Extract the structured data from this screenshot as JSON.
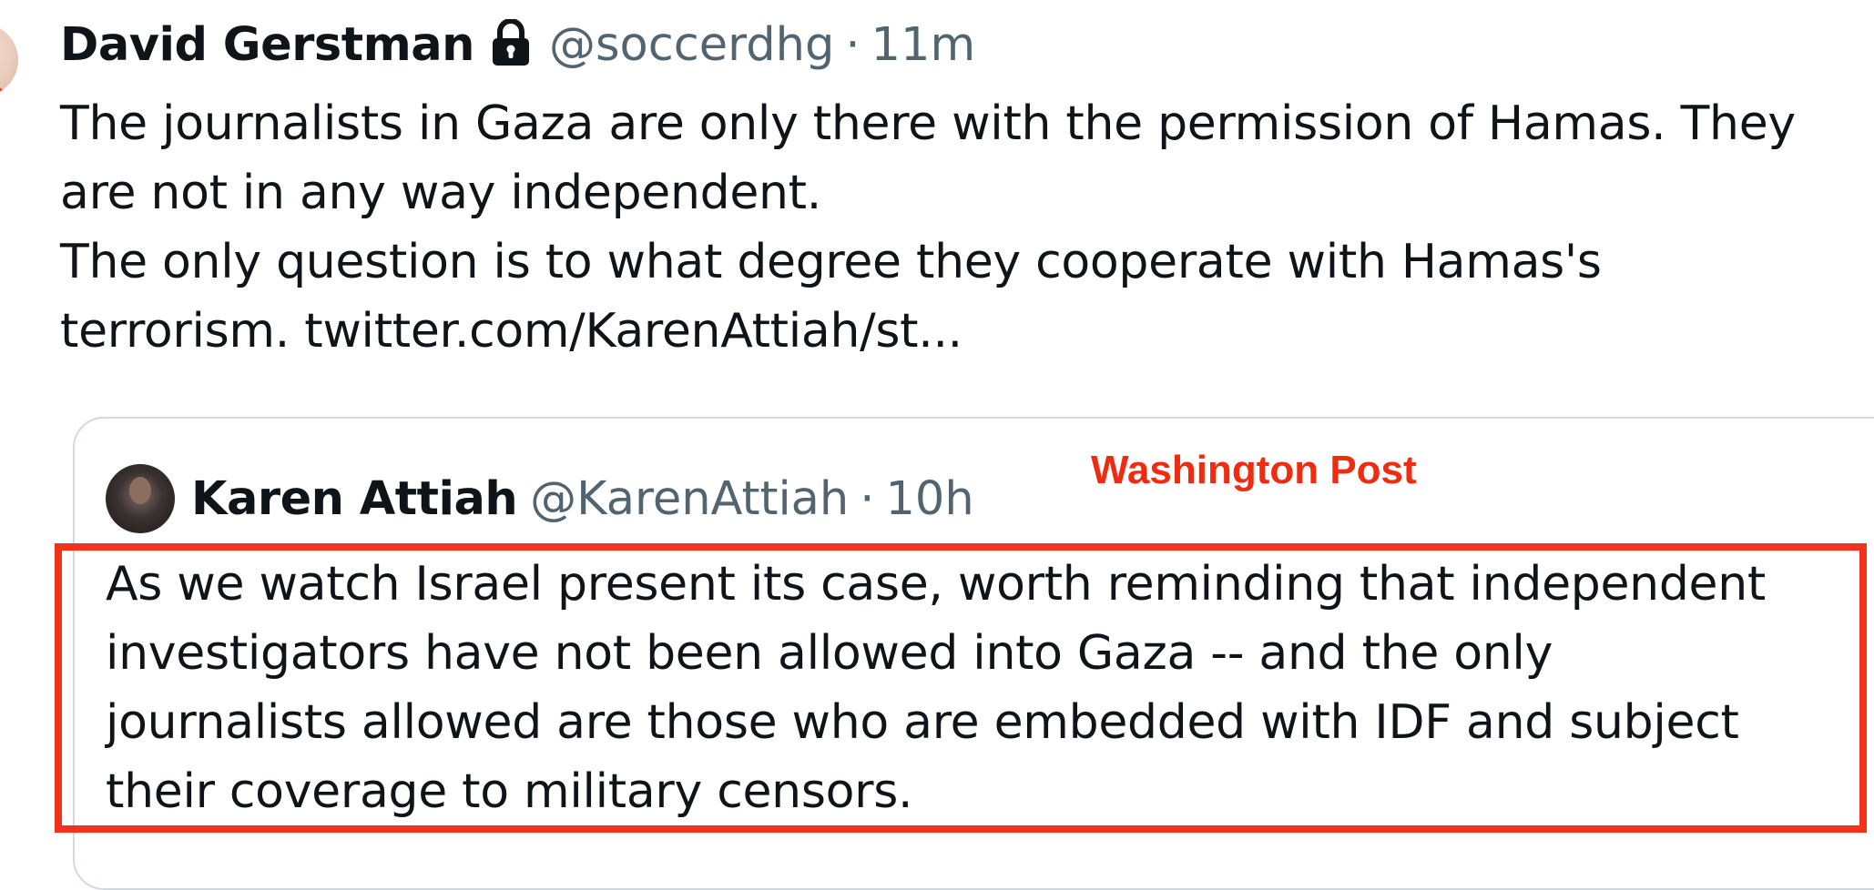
{
  "tweet": {
    "author_name": "David Gerstman",
    "handle": "@soccerdhg",
    "separator": "·",
    "time": "11m",
    "lock_icon": "lock-icon",
    "text_lines": [
      "The journalists in Gaza are only there with the permission of Hamas. They",
      "are not in any way independent.",
      "The only question is to what degree they cooperate with Hamas's",
      "terrorism. twitter.com/KarenAttiah/st..."
    ]
  },
  "quote": {
    "author_name": "Karen Attiah",
    "handle": "@KarenAttiah",
    "separator": "·",
    "time": "10h",
    "text_lines": [
      "As we watch Israel present its case, worth reminding that independent",
      "investigators have not been allowed into Gaza --  and the only",
      "journalists allowed are those who are embedded with IDF and subject",
      "their coverage to military censors."
    ]
  },
  "annotation": {
    "label": "Washington Post",
    "color": "#ef2b10"
  },
  "colors": {
    "text": "#0f1419",
    "muted": "#536471",
    "card_border": "#cfd9de",
    "highlight": "#f2321a"
  }
}
